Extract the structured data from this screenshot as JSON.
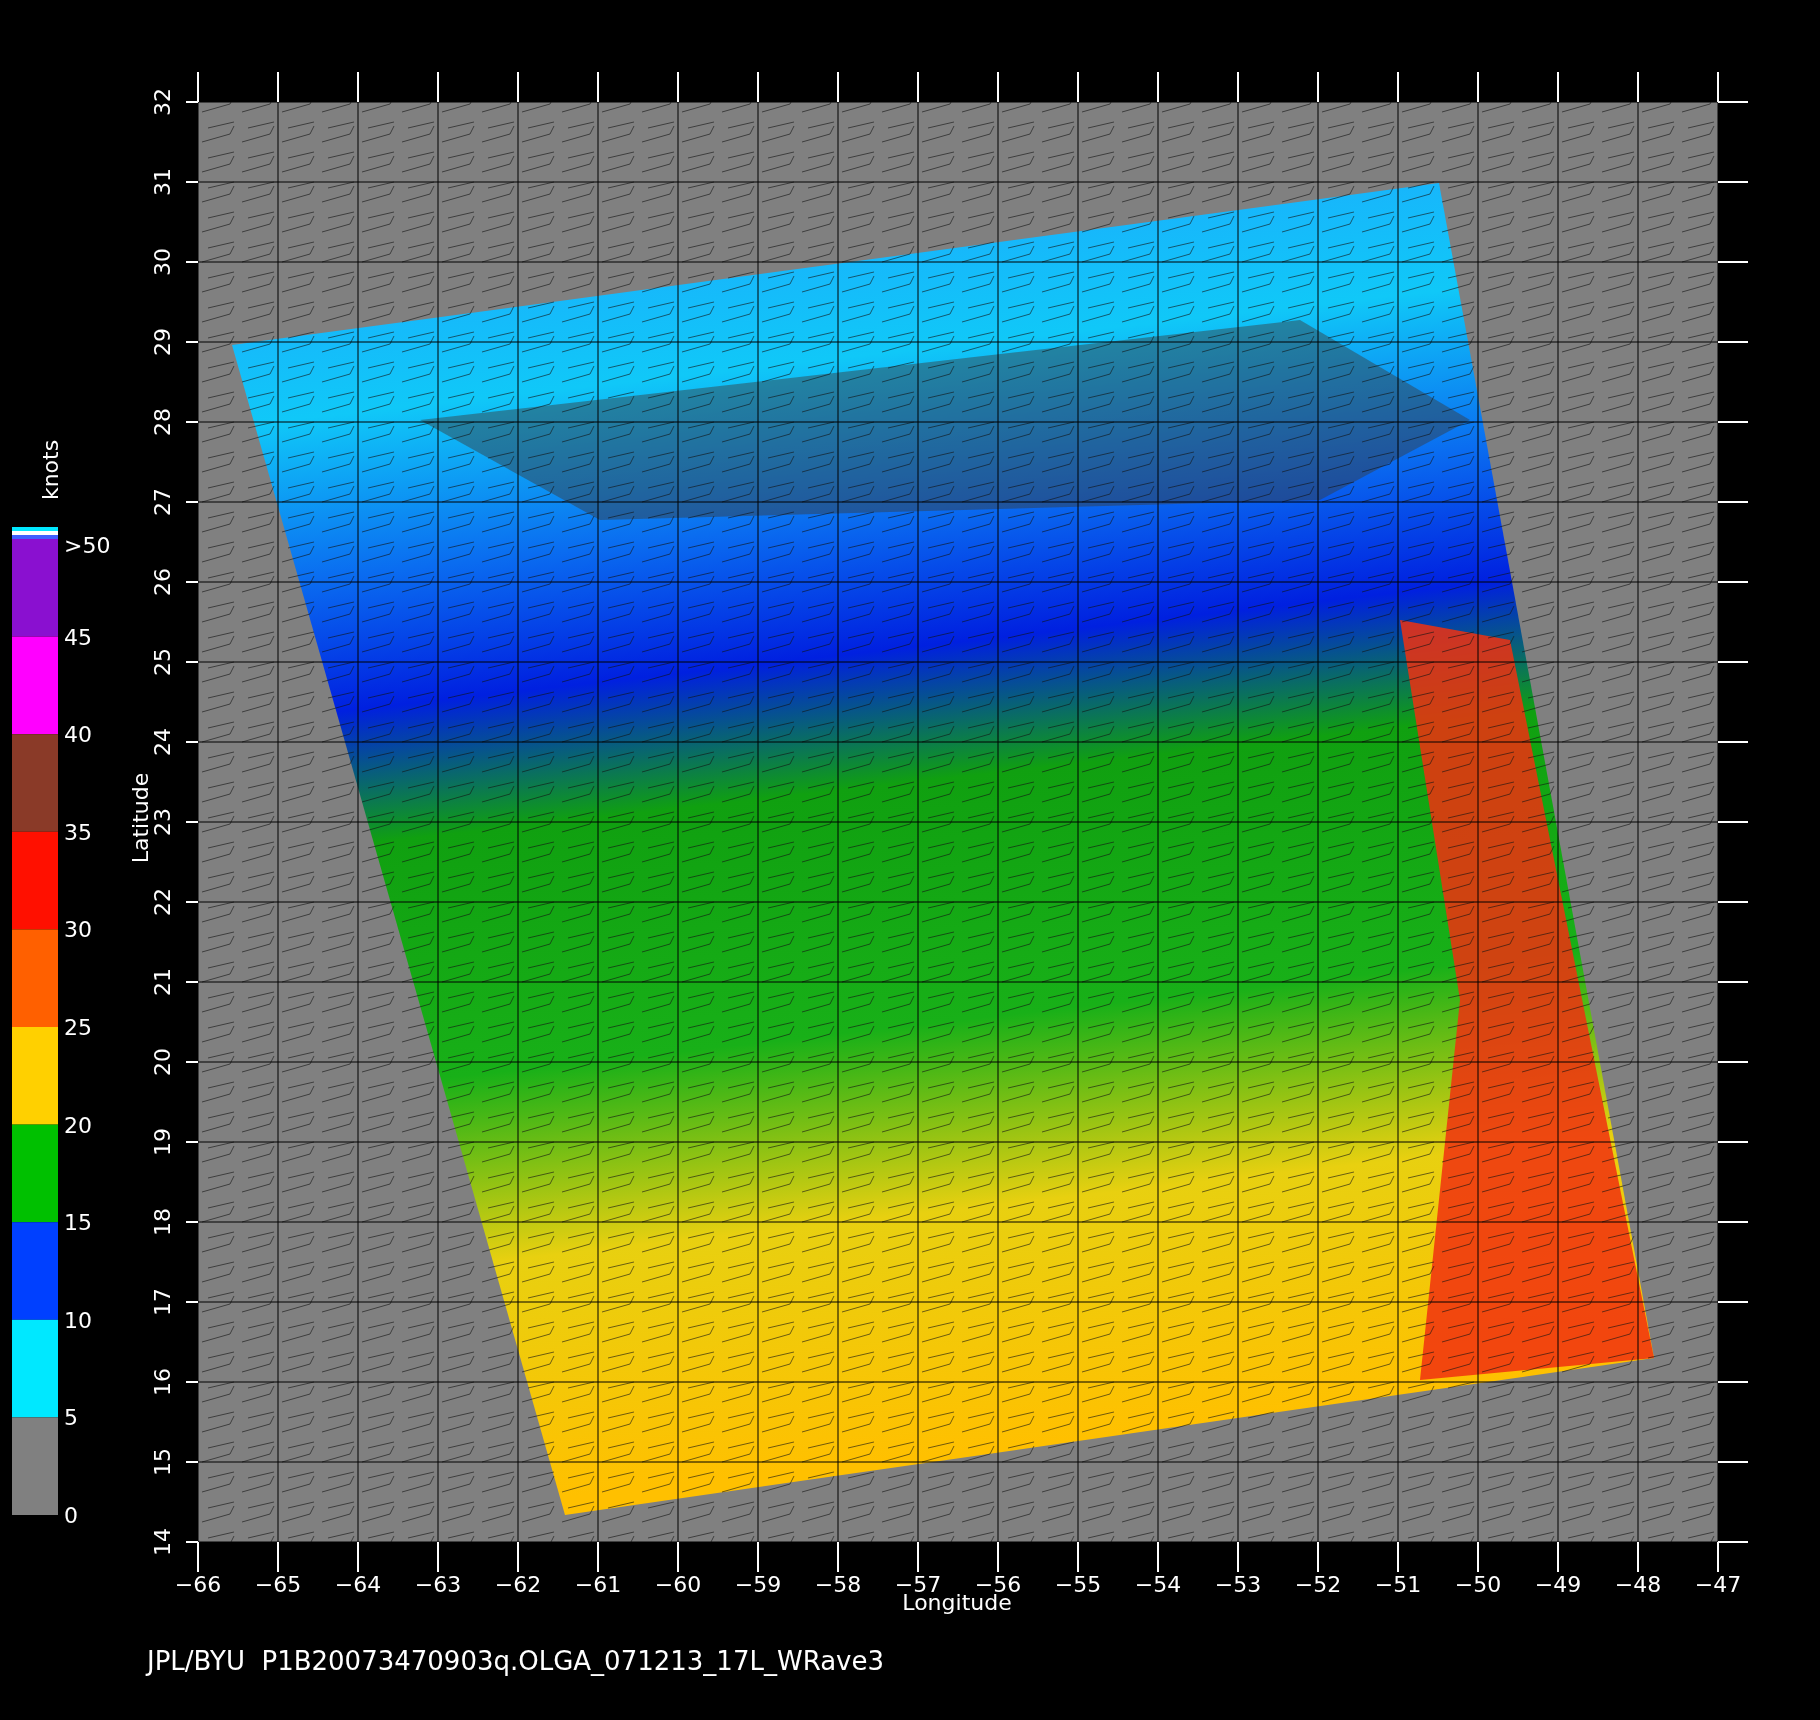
{
  "plot": {
    "x_axis": {
      "title": "Longitude",
      "ticks": [
        "−66",
        "−65",
        "−64",
        "−63",
        "−62",
        "−61",
        "−60",
        "−59",
        "−58",
        "−57",
        "−56",
        "−55",
        "−54",
        "−53",
        "−52",
        "−51",
        "−50",
        "−49",
        "−48",
        "−47"
      ]
    },
    "y_axis": {
      "title": "Latitude",
      "ticks": [
        "14",
        "15",
        "16",
        "17",
        "18",
        "19",
        "20",
        "21",
        "22",
        "23",
        "24",
        "25",
        "26",
        "27",
        "28",
        "29",
        "30",
        "31",
        "32"
      ]
    }
  },
  "colorbar": {
    "unit": "knots",
    "top_label": ">50",
    "segments": [
      {
        "label": "45",
        "color": "#8a10d0"
      },
      {
        "label": "40",
        "color": "#ff00ff"
      },
      {
        "label": "35",
        "color": "#8a3a28"
      },
      {
        "label": "30",
        "color": "#ff1000"
      },
      {
        "label": "25",
        "color": "#ff6000"
      },
      {
        "label": "20",
        "color": "#ffd000"
      },
      {
        "label": "15",
        "color": "#00c000"
      },
      {
        "label": "10",
        "color": "#0040ff"
      },
      {
        "label": "5",
        "color": "#00e8ff"
      },
      {
        "label": "0",
        "color": "#808080"
      }
    ]
  },
  "caption": "JPL/BYU  P1B20073470903q.OLGA_071213_17L_WRave3"
}
